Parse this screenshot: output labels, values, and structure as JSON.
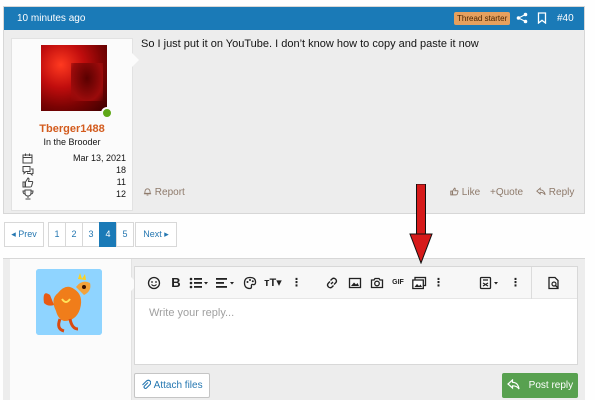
{
  "post": {
    "time": "10 minutes ago",
    "badge": "Thread starter",
    "post_number": "#40",
    "body": "So I just put it on YouTube. I don’t know how to copy and paste it now",
    "author": {
      "name": "Tberger1488",
      "title": "In the Brooder",
      "stats": [
        {
          "icon": "calendar-icon",
          "value": "Mar 13, 2021"
        },
        {
          "icon": "messages-icon",
          "value": "18"
        },
        {
          "icon": "reactions-icon",
          "value": "11"
        },
        {
          "icon": "trophy-icon",
          "value": "12"
        }
      ]
    },
    "actions": {
      "report": "Report",
      "like": "Like",
      "quote": "+Quote",
      "reply": "Reply"
    }
  },
  "pager": {
    "prev": "◂ Prev",
    "pages": [
      "1",
      "2",
      "3",
      "4",
      "5"
    ],
    "current": "4",
    "next": "Next ▸"
  },
  "editor": {
    "placeholder": "Write your reply...",
    "toolbar": [
      "smile-icon",
      "bold-icon",
      "list-icon",
      "align-icon",
      "palette-icon",
      "text-size-icon",
      "more-icon",
      "link-icon",
      "image-icon",
      "camera-icon",
      "gif-icon",
      "media-gallery-icon",
      "more-icon",
      "template-icon",
      "more-icon",
      "preview-icon"
    ],
    "gif_label": "GIF"
  },
  "buttons": {
    "attach": "Attach files",
    "post_reply": "Post reply"
  },
  "colors": {
    "header_blue": "#1a7ab7",
    "username_orange": "#d35b1d",
    "post_reply_green": "#58a150",
    "arrow_red": "#d61a1a"
  }
}
